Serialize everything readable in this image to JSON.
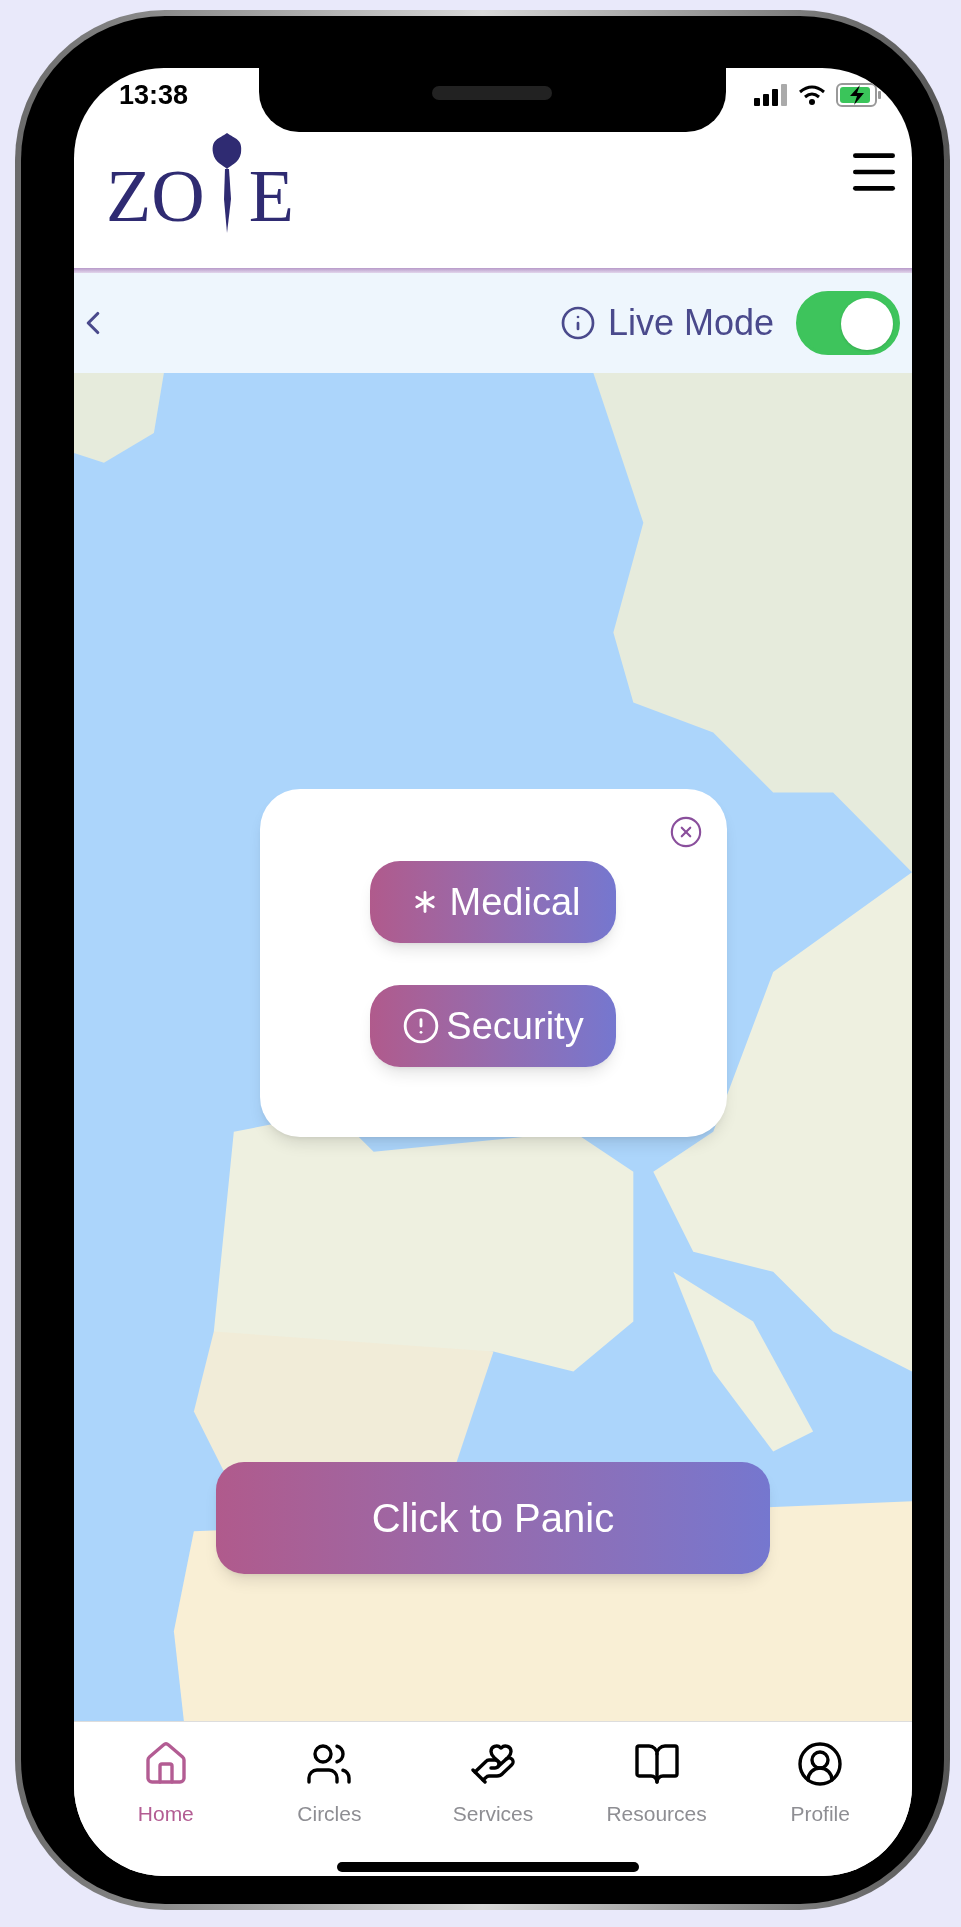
{
  "status_bar": {
    "time": "13:38"
  },
  "header": {
    "logo_left": "ZO",
    "logo_right": "E"
  },
  "top_bar": {
    "live_mode": {
      "label": "Live Mode",
      "on": true
    }
  },
  "popup": {
    "buttons": [
      {
        "kind": "medical",
        "label": "Medical"
      },
      {
        "kind": "security",
        "label": "Security"
      }
    ]
  },
  "panic_button": {
    "label": "Click to Panic"
  },
  "nav": {
    "items": [
      {
        "kind": "home",
        "label": "Home",
        "selected": true
      },
      {
        "kind": "circles",
        "label": "Circles",
        "selected": false
      },
      {
        "kind": "services",
        "label": "Services",
        "selected": false
      },
      {
        "kind": "resources",
        "label": "Resources",
        "selected": false
      },
      {
        "kind": "profile",
        "label": "Profile",
        "selected": false
      }
    ]
  }
}
